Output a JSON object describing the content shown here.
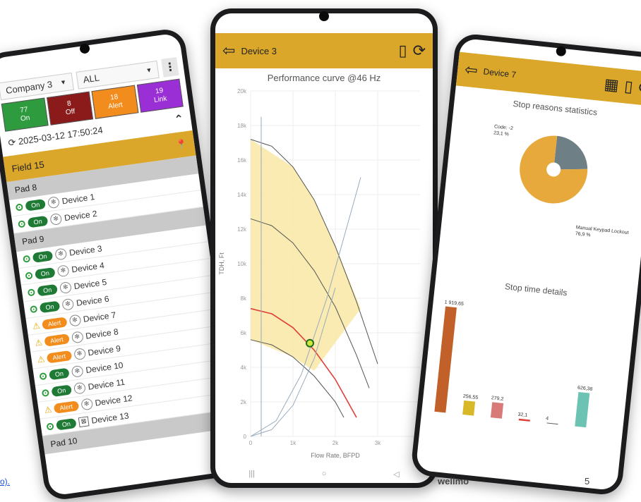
{
  "left_phone": {
    "company": "Company 3",
    "filter": "ALL",
    "menu": "⋮",
    "status": [
      {
        "count": "77",
        "label": "On",
        "kind": "on"
      },
      {
        "count": "8",
        "label": "Off",
        "kind": "off"
      },
      {
        "count": "18",
        "label": "Alert",
        "kind": "alert"
      },
      {
        "count": "19",
        "label": "Link",
        "kind": "link"
      }
    ],
    "timestamp": "2025-03-12 17:50:24",
    "field": "Field 15",
    "pads": [
      {
        "name": "Pad 8",
        "devices": [
          {
            "name": "Device 1",
            "state": "On"
          },
          {
            "name": "Device 2",
            "state": "On"
          }
        ]
      },
      {
        "name": "Pad 9",
        "devices": [
          {
            "name": "Device 3",
            "state": "On"
          },
          {
            "name": "Device 4",
            "state": "On"
          },
          {
            "name": "Device 5",
            "state": "On"
          },
          {
            "name": "Device 6",
            "state": "On"
          },
          {
            "name": "Device 7",
            "state": "Alert"
          },
          {
            "name": "Device 8",
            "state": "Alert"
          },
          {
            "name": "Device 9",
            "state": "Alert"
          },
          {
            "name": "Device 10",
            "state": "On"
          },
          {
            "name": "Device 11",
            "state": "On"
          },
          {
            "name": "Device 12",
            "state": "Alert"
          },
          {
            "name": "Device 13",
            "state": "On"
          }
        ]
      },
      {
        "name": "Pad 10",
        "devices": []
      }
    ]
  },
  "center_phone": {
    "title": "Device 3",
    "chart_title": "Performance curve @46 Hz",
    "xlabel": "Flow Rate, BFPD",
    "ylabel": "TDH, Ft"
  },
  "right_phone": {
    "title": "Device 7",
    "stop_reasons_title": "Stop reasons statistics",
    "stop_time_title": "Stop time details"
  },
  "colors": {
    "gold": "#dba72a",
    "on": "#2e9b3e",
    "off": "#8b1a1a",
    "alert": "#f28c1c",
    "link": "#9b2fd6",
    "envelope": "#f8e9a8",
    "operating_curve": "#e0403a"
  },
  "chart_data": [
    {
      "type": "line",
      "title": "Performance curve @46 Hz",
      "xlabel": "Flow Rate, BFPD",
      "ylabel": "TDH, Ft",
      "xlim": [
        0,
        4000
      ],
      "ylim": [
        0,
        20000
      ],
      "x_ticks": [
        "0",
        "1k",
        "2k",
        "3k"
      ],
      "y_ticks": [
        "0",
        "2k",
        "4k",
        "6k",
        "8k",
        "10k",
        "12k",
        "14k",
        "16k",
        "18k",
        "20k"
      ],
      "grid": true,
      "series": [
        {
          "values": [
            [
              0,
              17200
            ],
            [
              500,
              16800
            ],
            [
              1000,
              15600
            ],
            [
              1500,
              13700
            ],
            [
              2000,
              11000
            ],
            [
              2500,
              7800
            ],
            [
              3000,
              4200
            ]
          ]
        },
        {
          "values": [
            [
              0,
              12600
            ],
            [
              500,
              12200
            ],
            [
              1000,
              11200
            ],
            [
              1500,
              9600
            ],
            [
              2000,
              7500
            ],
            [
              2500,
              4700
            ],
            [
              2800,
              2800
            ]
          ]
        },
        {
          "values": [
            [
              0,
              7400
            ],
            [
              500,
              7100
            ],
            [
              1000,
              6300
            ],
            [
              1500,
              5000
            ],
            [
              2000,
              3300
            ],
            [
              2500,
              1100
            ]
          ]
        },
        {
          "values": [
            [
              0,
              5600
            ],
            [
              500,
              5300
            ],
            [
              1000,
              4600
            ],
            [
              1500,
              3500
            ],
            [
              2000,
              2000
            ],
            [
              2200,
              1100
            ]
          ]
        },
        {
          "values": [
            [
              0,
              0
            ],
            [
              600,
              900
            ],
            [
              1200,
              3600
            ],
            [
              1800,
              8000
            ],
            [
              2200,
              11500
            ],
            [
              2600,
              15000
            ]
          ]
        },
        {
          "values": [
            [
              0,
              0
            ],
            [
              500,
              400
            ],
            [
              1000,
              1800
            ],
            [
              1500,
              4500
            ],
            [
              2000,
              8600
            ]
          ]
        },
        {
          "values": [
            [
              250,
              0
            ],
            [
              250,
              18500
            ]
          ]
        }
      ],
      "operating_point": [
        1400,
        5400
      ]
    },
    {
      "type": "pie",
      "labels": [
        "Code: -2",
        "Manual Keypad Lockout"
      ],
      "values": [
        23.1,
        76.9
      ],
      "value_labels": [
        "23,1 %",
        "76,9 %"
      ]
    },
    {
      "type": "bar",
      "values": [
        1919.65,
        256.55,
        279.2,
        32.1,
        4,
        626.38
      ],
      "data_labels": [
        "1 919,65",
        "256,55",
        "279,2",
        "32,1",
        "4",
        "626,38"
      ]
    }
  ],
  "footer": {
    "link_text": "o).",
    "brand": "wellmo",
    "page_number": "5"
  }
}
